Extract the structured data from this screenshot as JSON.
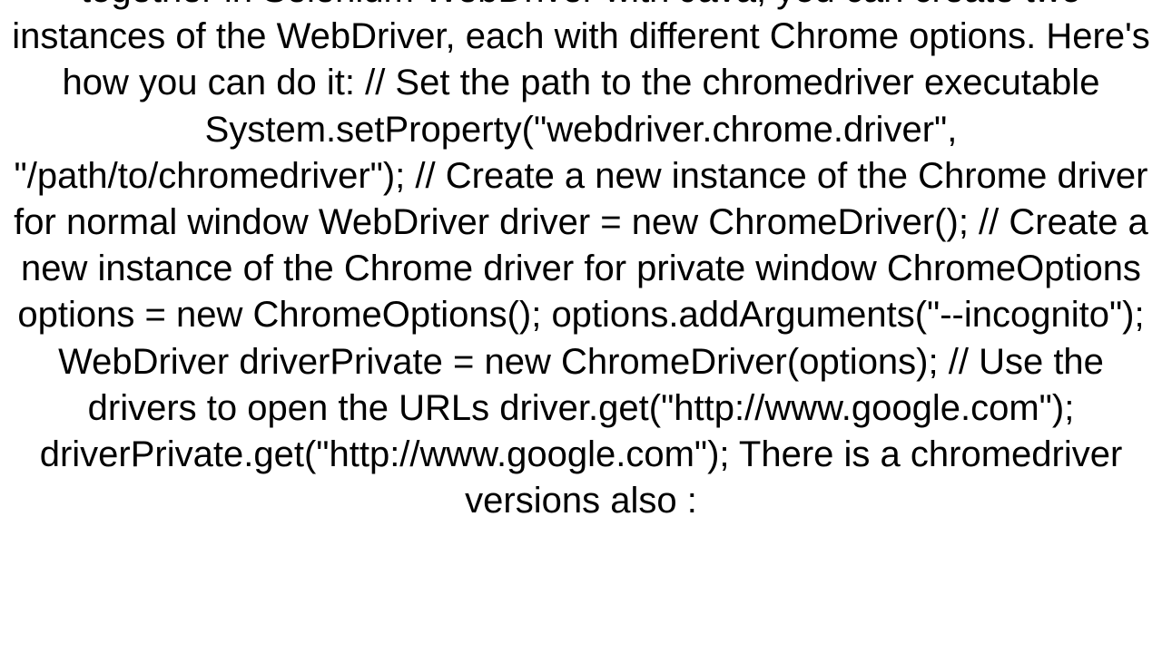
{
  "body": "together in Selenium WebDriver with Java, you can create two instances of the WebDriver, each with different Chrome options. Here's how you can do it:     // Set the path to the chromedriver executable     System.setProperty(\"webdriver.chrome.driver\", \"/path/to/chromedriver\");      // Create a new instance of the Chrome driver for normal window     WebDriver driver = new ChromeDriver();      // Create a new instance of the Chrome driver for private window     ChromeOptions options = new ChromeOptions();     options.addArguments(\"--incognito\");     WebDriver driverPrivate = new ChromeDriver(options);      // Use the drivers to open the URLs     driver.get(\"http://www.google.com\");     driverPrivate.get(\"http://www.google.com\");  There is a chromedriver versions also :"
}
